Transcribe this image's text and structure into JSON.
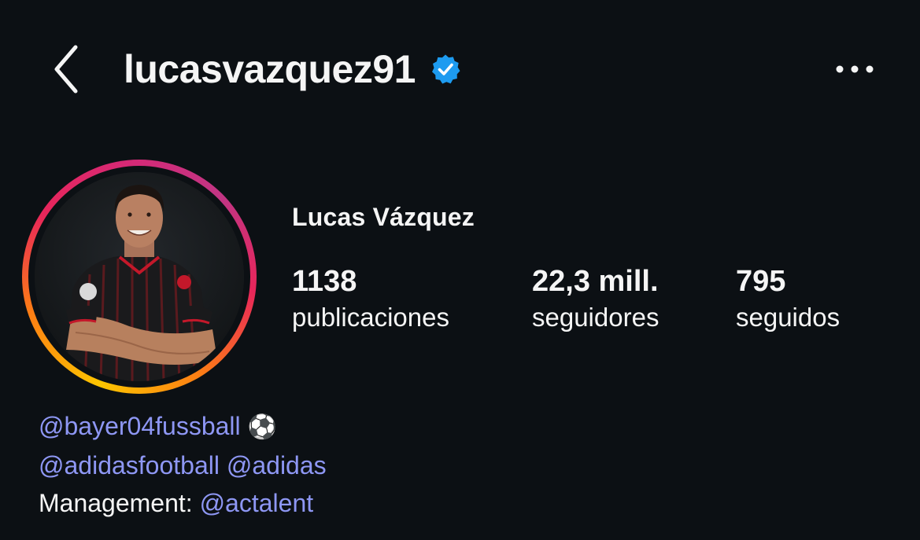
{
  "header": {
    "username": "lucasvazquez91",
    "verified": true,
    "back_icon": "chevron-left-icon",
    "more_icon": "more-horizontal-icon",
    "verified_color": "#1d9bf0"
  },
  "profile": {
    "full_name": "Lucas Vázquez",
    "story_ring_colors": [
      "#fdc500",
      "#fd7e14",
      "#e8265a",
      "#d62976",
      "#c13584"
    ]
  },
  "stats": [
    {
      "value": "1138",
      "label": "publicaciones"
    },
    {
      "value": "22,3 mill.",
      "label": "seguidores"
    },
    {
      "value": "795",
      "label": "seguidos"
    }
  ],
  "bio": {
    "line1": {
      "mention": "@bayer04fussball",
      "emoji": "⚽"
    },
    "line2": {
      "mention1": "@adidasfootball",
      "mention2": "@adidas"
    },
    "line3": {
      "text": "Management: ",
      "mention": "@actalent"
    },
    "mention_color": "#8e97f4"
  }
}
